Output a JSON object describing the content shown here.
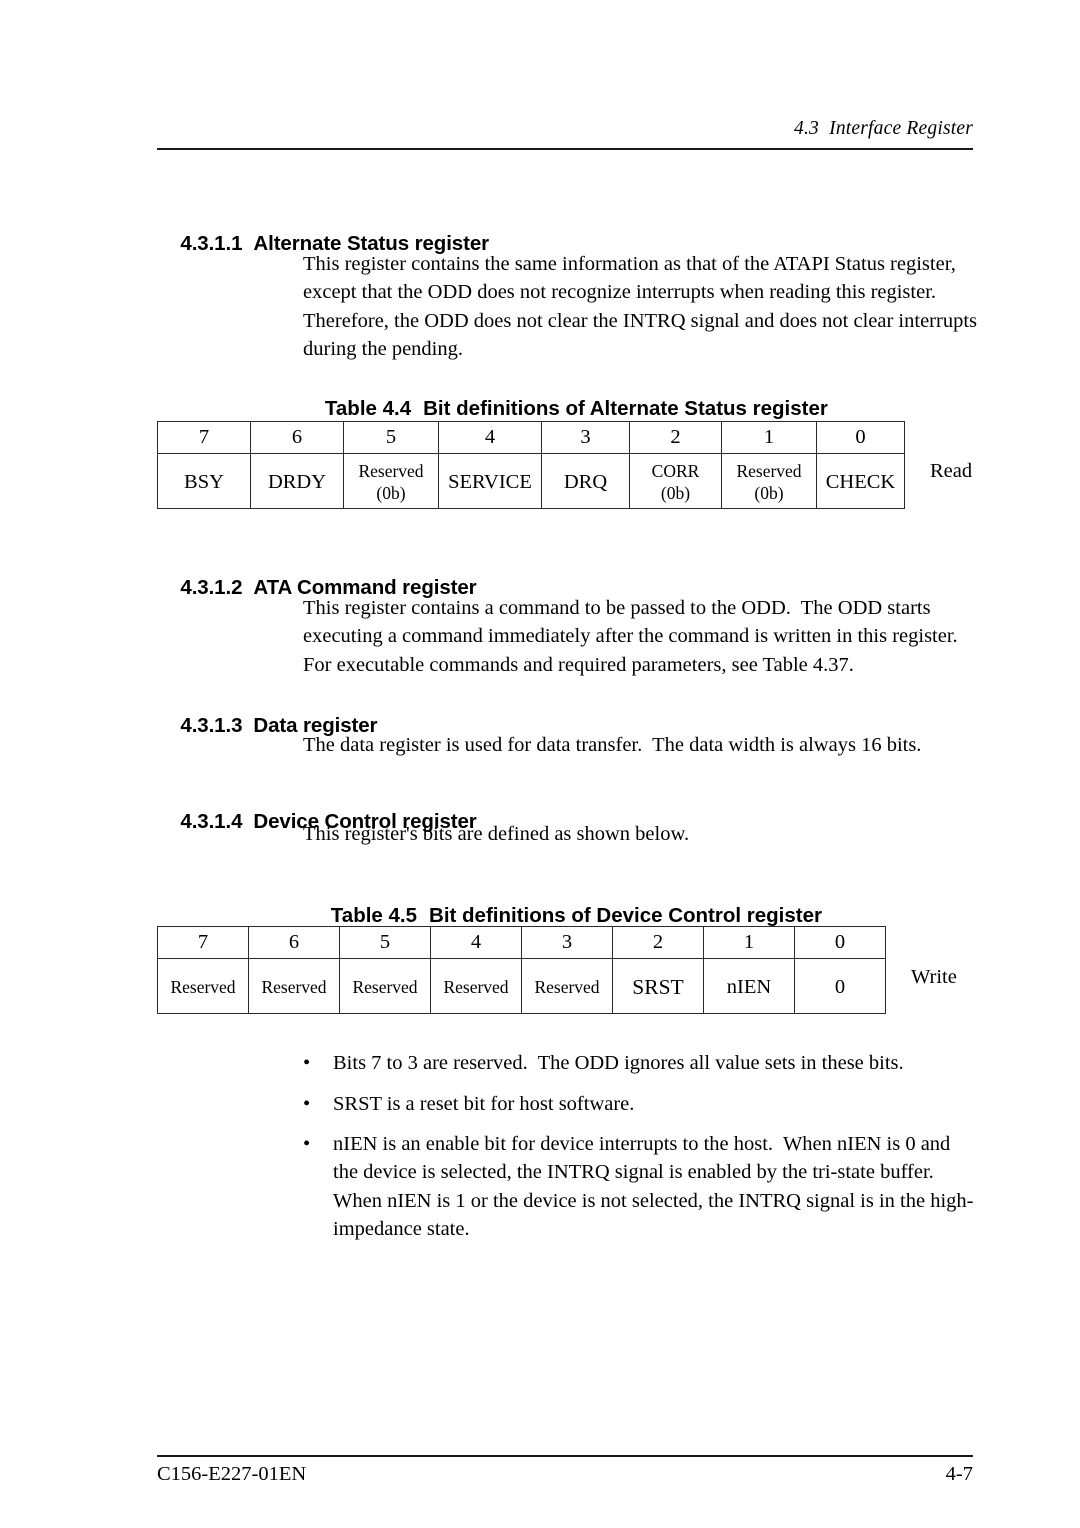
{
  "header": {
    "running_head": "4.3  Interface Register"
  },
  "sections": [
    {
      "number": "4.3.1.1",
      "title": "Alternate Status register",
      "paragraph_lines": [
        "This register contains the same information as that of the ATAPI Status register,",
        "except that the ODD does not recognize interrupts when reading this register.",
        "Therefore, the ODD does not clear the INTRQ signal and does not clear interrupts",
        "during the pending."
      ]
    },
    {
      "number": "4.3.1.2",
      "title": "ATA Command register",
      "paragraph_lines": [
        "This register contains a command to be passed to the ODD.  The ODD starts",
        "executing a command immediately after the command is written in this register.",
        "For executable commands and required parameters, see Table 4.37."
      ]
    },
    {
      "number": "4.3.1.3",
      "title": "Data register",
      "paragraph_lines": [
        "The data register is used for data transfer.  The data width is always 16 bits."
      ]
    },
    {
      "number": "4.3.1.4",
      "title": "Device Control register",
      "paragraph_lines": [
        "This register's bits are defined as shown below."
      ]
    }
  ],
  "table_44": {
    "caption_number": "Table 4.4",
    "caption_title": "Bit definitions of Alternate Status register",
    "bit_indexes": [
      "7",
      "6",
      "5",
      "4",
      "3",
      "2",
      "1",
      "0"
    ],
    "bit_names": [
      {
        "main": "BSY",
        "sub": ""
      },
      {
        "main": "DRDY",
        "sub": ""
      },
      {
        "main": "Reserved",
        "sub": "(0b)"
      },
      {
        "main": "SERVICE",
        "sub": ""
      },
      {
        "main": "DRQ",
        "sub": ""
      },
      {
        "main": "CORR",
        "sub": "(0b)"
      },
      {
        "main": "Reserved",
        "sub": "(0b)"
      },
      {
        "main": "CHECK",
        "sub": ""
      }
    ],
    "access_label": "Read"
  },
  "table_45": {
    "caption_number": "Table 4.5",
    "caption_title": "Bit definitions of Device Control register",
    "bit_indexes": [
      "7",
      "6",
      "5",
      "4",
      "3",
      "2",
      "1",
      "0"
    ],
    "bit_names": [
      {
        "main": "Reserved",
        "sub": ""
      },
      {
        "main": "Reserved",
        "sub": ""
      },
      {
        "main": "Reserved",
        "sub": ""
      },
      {
        "main": "Reserved",
        "sub": ""
      },
      {
        "main": "Reserved",
        "sub": ""
      },
      {
        "main": "SRST",
        "sub": ""
      },
      {
        "main": "nIEN",
        "sub": ""
      },
      {
        "main": "0",
        "sub": ""
      }
    ],
    "access_label": "Write"
  },
  "bullets": [
    {
      "marker": "•",
      "lines": [
        "Bits 7 to 3 are reserved.  The ODD ignores all value sets in these bits."
      ]
    },
    {
      "marker": "•",
      "lines": [
        "SRST is a reset bit for host software."
      ]
    },
    {
      "marker": "•",
      "lines": [
        "nIEN is an enable bit for device interrupts to the host.  When nIEN is 0 and",
        "the device is selected, the INTRQ signal is enabled by the tri-state buffer.",
        "When nIEN is 1 or the device is not selected, the INTRQ signal is in the high-",
        "impedance state."
      ]
    }
  ],
  "footer": {
    "document_id": "C156-E227-01EN",
    "page_number": "4-7"
  }
}
